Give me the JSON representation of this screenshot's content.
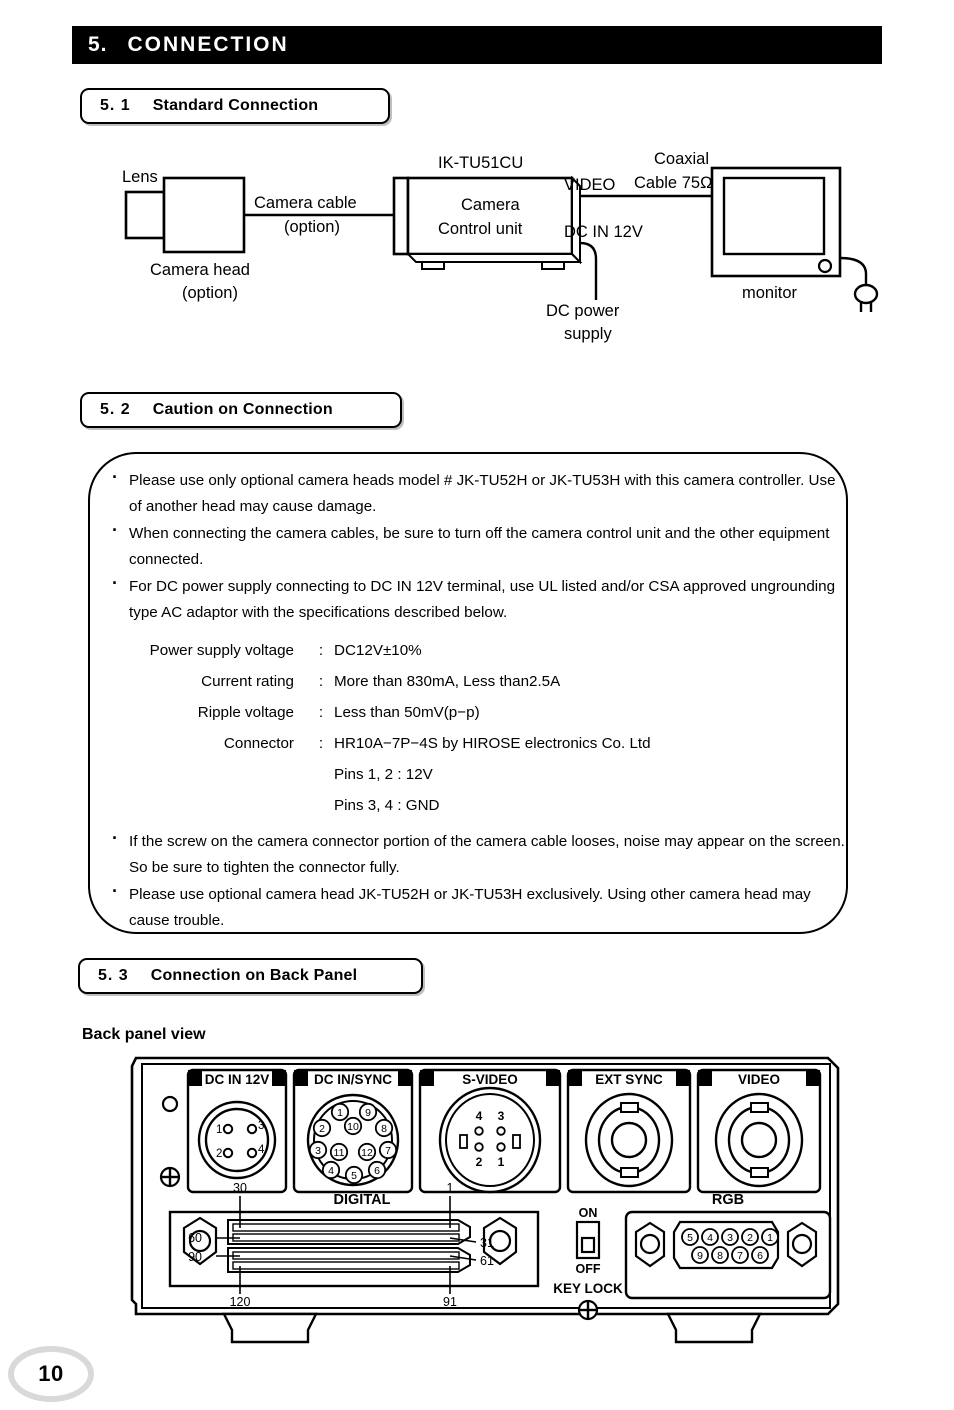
{
  "chapter": {
    "number": "5.",
    "title": "CONNECTION"
  },
  "sections": {
    "s1": {
      "number": "5. 1",
      "title": "Standard Connection"
    },
    "s2": {
      "number": "5. 2",
      "title": "Caution on Connection"
    },
    "s3": {
      "number": "5. 3",
      "title": "Connection on Back Panel"
    }
  },
  "diagram": {
    "lens": "Lens",
    "camera_head": "Camera head",
    "camera_head_option": "(option)",
    "camera_cable": "Camera cable",
    "camera_cable_option": "(option)",
    "unit_model": "IK-TU51CU",
    "unit_name_line1": "Camera",
    "unit_name_line2": "Control unit",
    "video_label": "VIDEO",
    "dc_in_label": "DC IN 12V",
    "coax_line1": "Coaxial",
    "coax_line2": "Cable 75Ω",
    "dc_power_line1": "DC power",
    "dc_power_line2": "supply",
    "monitor": "monitor"
  },
  "caution": {
    "bullets_top": [
      "Please use only optional camera heads model # JK-TU52H or JK-TU53H with this camera controller. Use of another head may cause damage.",
      "When connecting the camera cables, be sure to turn off the camera control unit and the other equipment connected.",
      "For DC power supply connecting to DC IN 12V terminal, use UL listed and/or CSA approved ungrounding type AC adaptor with the specifications described below."
    ],
    "specs": [
      {
        "label": "Power supply voltage",
        "colon": ":",
        "value": "DC12V±10%"
      },
      {
        "label": "Current rating",
        "colon": ":",
        "value": "More than 830mA, Less than2.5A"
      },
      {
        "label": "Ripple voltage",
        "colon": ":",
        "value": "Less than 50mV(p−p)"
      },
      {
        "label": "Connector",
        "colon": ":",
        "value": "HR10A−7P−4S by HIROSE electronics Co. Ltd"
      }
    ],
    "spec_sublines": [
      "Pins 1, 2  :  12V",
      "Pins 3, 4  :  GND"
    ],
    "bullets_bottom": [
      "If the screw on the camera connector portion of the camera cable looses, noise may appear on the screen. So be sure to tighten the connector fully.",
      "Please use optional camera head JK-TU52H or JK-TU53H exclusively. Using other camera head may cause trouble."
    ]
  },
  "backpanel": {
    "heading": "Back panel view",
    "connectors": [
      {
        "label": "DC IN 12V",
        "pins": [
          "1",
          "3",
          "2",
          "4"
        ]
      },
      {
        "label": "DC IN/SYNC",
        "pins": [
          "1",
          "9",
          "2",
          "10",
          "8",
          "3",
          "11",
          "12",
          "7",
          "4",
          "5",
          "6"
        ]
      },
      {
        "label": "S-VIDEO",
        "pins": [
          "4",
          "3",
          "2",
          "1"
        ]
      },
      {
        "label": "EXT SYNC",
        "pins": []
      },
      {
        "label": "VIDEO",
        "pins": []
      }
    ],
    "digital": {
      "label": "DIGITAL",
      "pin_top_left": "30",
      "pin_top_right": "1",
      "pin_left_60": "60",
      "pin_left_90": "90",
      "pin_right_31": "31",
      "pin_right_61": "61",
      "pin_bottom_left": "120",
      "pin_bottom_right": "91"
    },
    "keylock": {
      "on": "ON",
      "off": "OFF",
      "label": "KEY LOCK",
      "position": "OFF"
    },
    "rgb": {
      "label": "RGB",
      "pins_top": [
        "5",
        "4",
        "3",
        "2",
        "1"
      ],
      "pins_bottom": [
        "9",
        "8",
        "7",
        "6"
      ]
    }
  },
  "page_number": "10"
}
